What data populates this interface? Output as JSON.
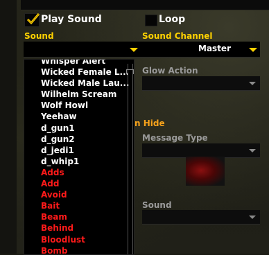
{
  "play_sound": {
    "label": "Play Sound",
    "checked": true
  },
  "loop": {
    "label": "Loop",
    "checked": false
  },
  "sound": {
    "label": "Sound",
    "value": ""
  },
  "sound_channel": {
    "label": "Sound Channel",
    "value": "Master"
  },
  "glow_action": {
    "label": "Glow Action",
    "value": ""
  },
  "on_hide": {
    "label": "n Hide"
  },
  "message_type": {
    "label": "Message Type",
    "value": ""
  },
  "sound2": {
    "label": "Sound",
    "value": ""
  },
  "sound_list": {
    "items": [
      {
        "label": "Whisper Alert",
        "color": "#ffffff"
      },
      {
        "label": "Wicked Female L...",
        "color": "#ffffff"
      },
      {
        "label": "Wicked Male Lau...",
        "color": "#ffffff"
      },
      {
        "label": "Wilhelm Scream",
        "color": "#ffffff"
      },
      {
        "label": "Wolf Howl",
        "color": "#ffffff"
      },
      {
        "label": "Yeehaw",
        "color": "#ffffff"
      },
      {
        "label": "d_gun1",
        "color": "#ffffff"
      },
      {
        "label": "d_gun2",
        "color": "#ffffff"
      },
      {
        "label": "d_jedi1",
        "color": "#ffffff"
      },
      {
        "label": "d_whip1",
        "color": "#ffffff"
      },
      {
        "label": "Adds",
        "color": "#ff1a1a"
      },
      {
        "label": "Add",
        "color": "#ff1a1a"
      },
      {
        "label": "Avoid",
        "color": "#ff1a1a"
      },
      {
        "label": "Bait",
        "color": "#ff1a1a"
      },
      {
        "label": "Beam",
        "color": "#ff1a1a"
      },
      {
        "label": "Behind",
        "color": "#ff1a1a"
      },
      {
        "label": "Bloodlust",
        "color": "#ff1a1a"
      },
      {
        "label": "Bomb",
        "color": "#ff1a1a"
      }
    ]
  },
  "colors": {
    "gold": "#ffd100",
    "orange": "#f7a21b",
    "red": "#ff1a1a"
  },
  "icons": {
    "check": "checkmark-icon",
    "dropdown": "chevron-down-icon"
  }
}
